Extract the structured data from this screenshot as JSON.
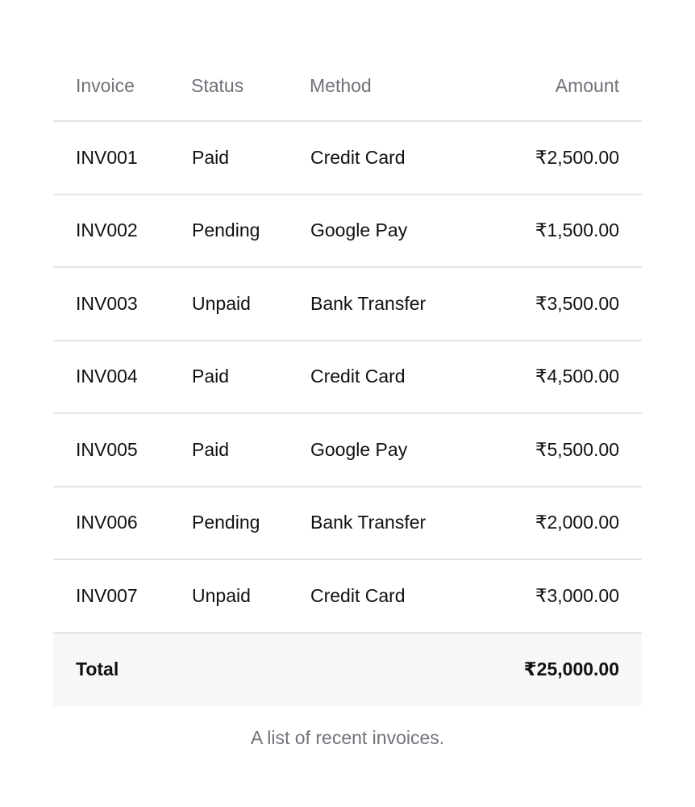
{
  "table": {
    "headers": {
      "invoice": "Invoice",
      "status": "Status",
      "method": "Method",
      "amount": "Amount"
    },
    "rows": [
      {
        "invoice": "INV001",
        "status": "Paid",
        "method": "Credit Card",
        "amount": "₹2,500.00"
      },
      {
        "invoice": "INV002",
        "status": "Pending",
        "method": "Google Pay",
        "amount": "₹1,500.00"
      },
      {
        "invoice": "INV003",
        "status": "Unpaid",
        "method": "Bank Transfer",
        "amount": "₹3,500.00"
      },
      {
        "invoice": "INV004",
        "status": "Paid",
        "method": "Credit Card",
        "amount": "₹4,500.00"
      },
      {
        "invoice": "INV005",
        "status": "Paid",
        "method": "Google Pay",
        "amount": "₹5,500.00"
      },
      {
        "invoice": "INV006",
        "status": "Pending",
        "method": "Bank Transfer",
        "amount": "₹2,000.00"
      },
      {
        "invoice": "INV007",
        "status": "Unpaid",
        "method": "Credit Card",
        "amount": "₹3,000.00"
      }
    ],
    "footer": {
      "label": "Total",
      "amount": "₹25,000.00"
    },
    "caption": "A list of recent invoices."
  }
}
